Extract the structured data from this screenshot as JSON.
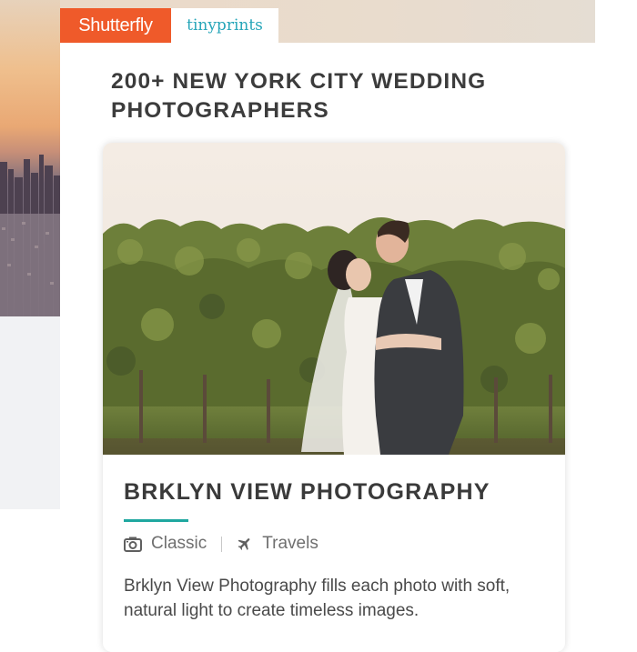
{
  "brand": {
    "shutterfly": "Shutterfly",
    "tinyprints": "tinyprints"
  },
  "page": {
    "title": "200+ NEW YORK CITY WEDDING PHOTOGRAPHERS"
  },
  "vendor_card": {
    "name": "BRKLYN VIEW PHOTOGRAPHY",
    "tags": [
      {
        "icon": "camera-icon",
        "label": "Classic"
      },
      {
        "icon": "airplane-icon",
        "label": "Travels"
      }
    ],
    "description": "Brklyn View Photography fills each photo with soft, natural light to create timeless images."
  },
  "colors": {
    "shutterfly_orange": "#ef5a2a",
    "tinyprints_teal": "#27a6b9",
    "accent_underline": "#1fa7a0",
    "heading_text": "#3c3c3c"
  }
}
